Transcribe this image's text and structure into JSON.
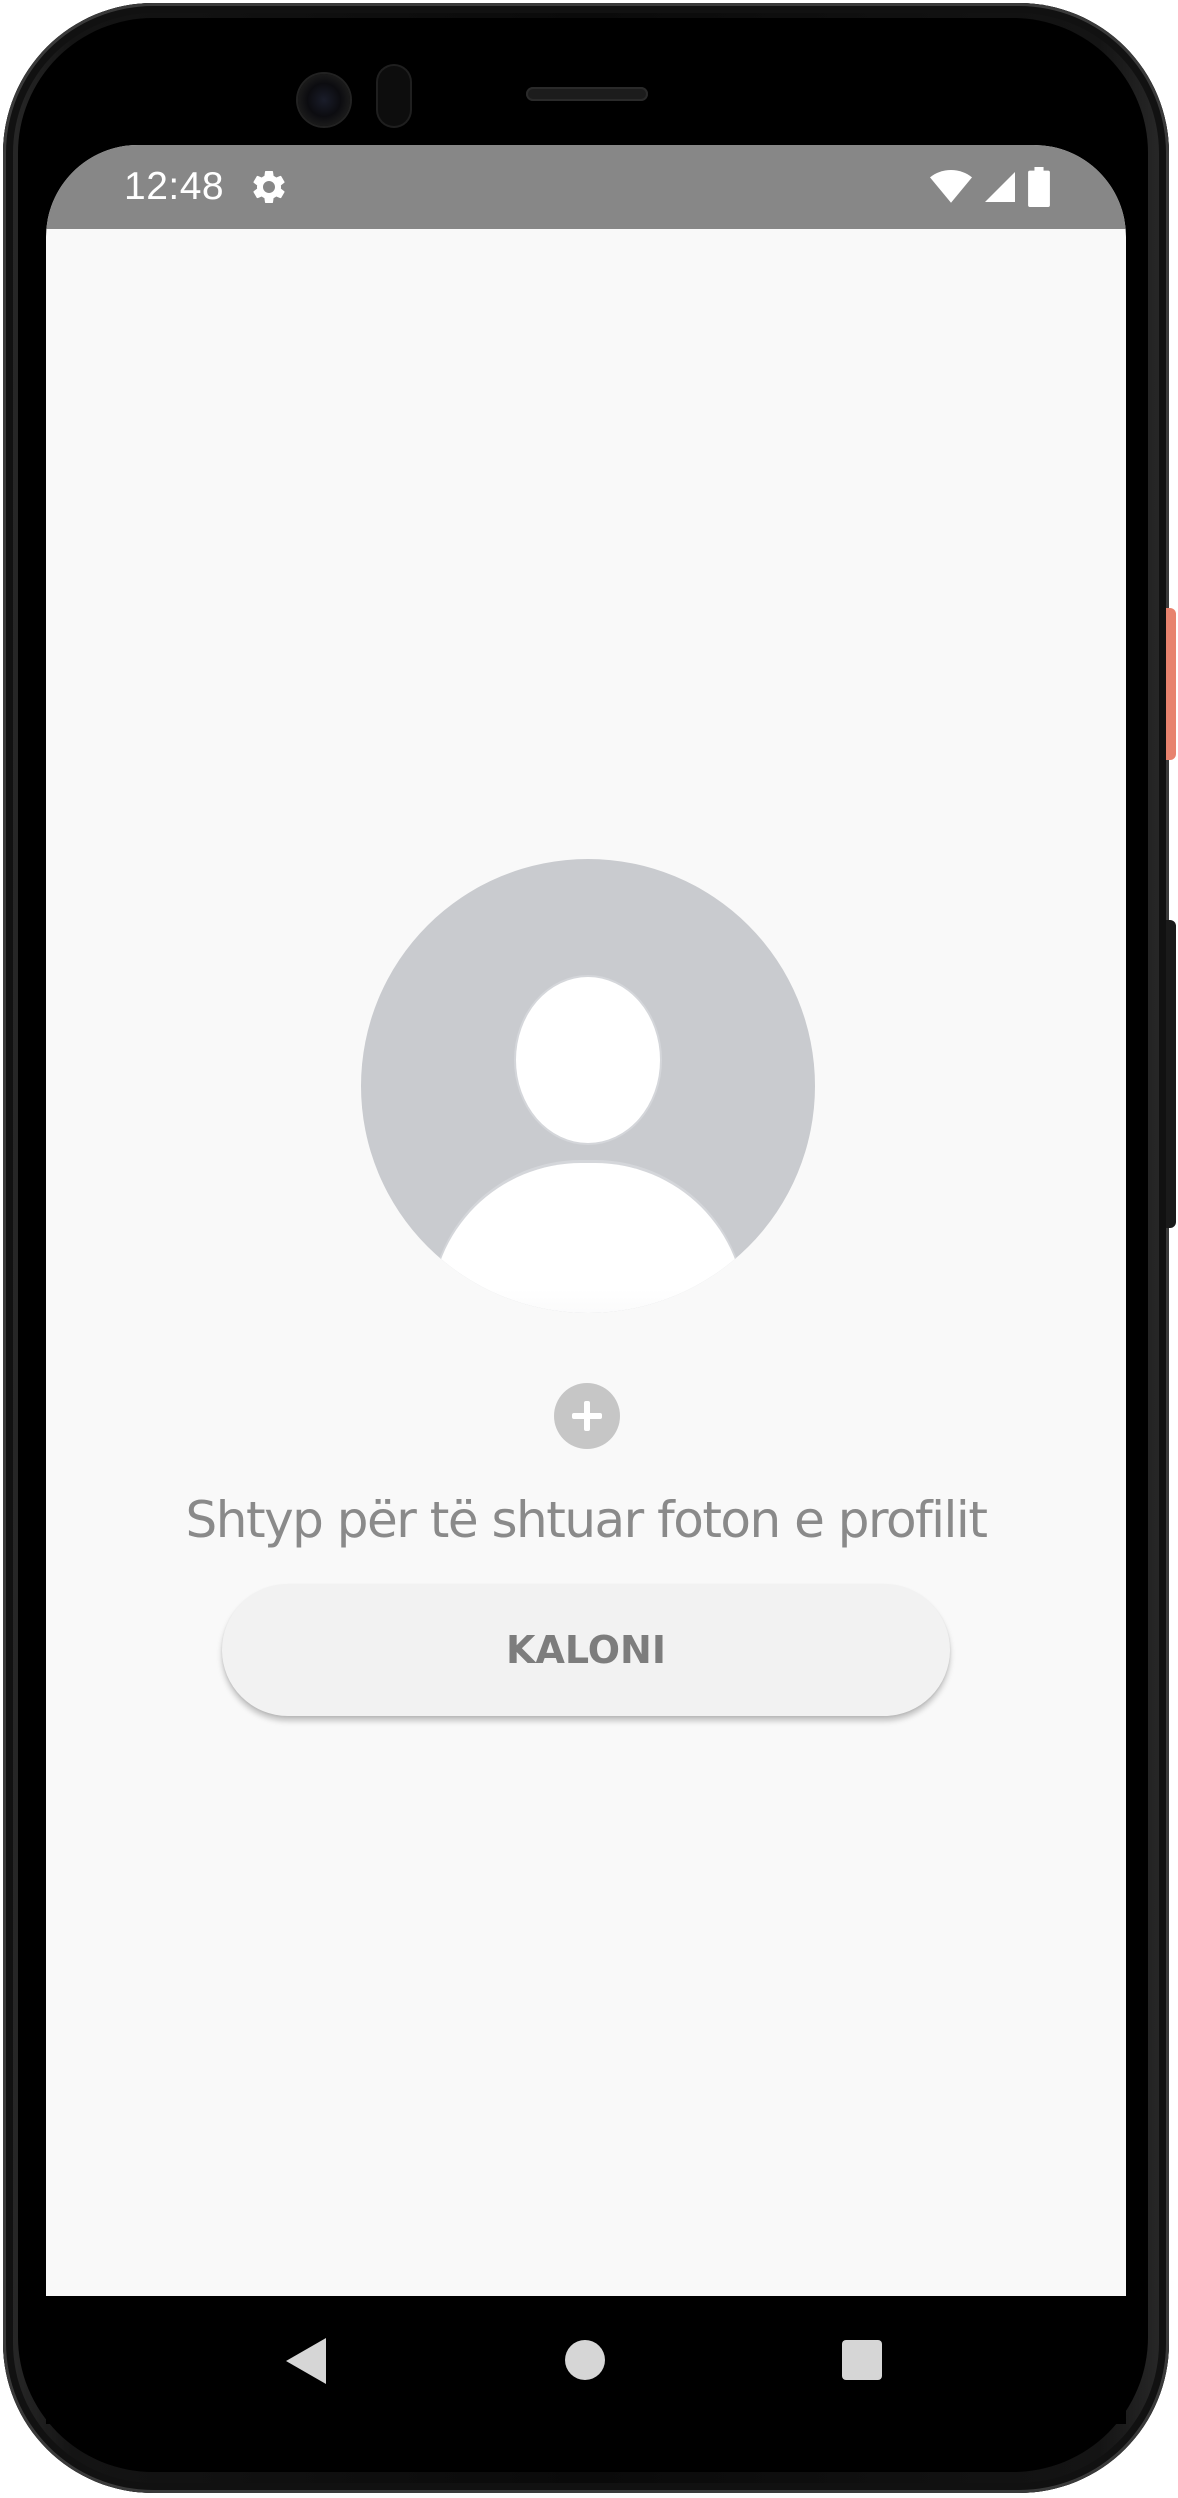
{
  "status_bar": {
    "time": "12:48",
    "icons": [
      "settings-icon",
      "wifi-icon",
      "cellular-signal-icon",
      "battery-icon"
    ],
    "background_color": "#878787"
  },
  "profile_setup": {
    "avatar_icon": "default-profile-avatar",
    "add_icon": "plus-icon",
    "prompt": "Shtyp për të shtuar foton e profilit",
    "skip_button_label": "KALONI"
  },
  "navigation_bar": {
    "buttons": [
      "back-icon",
      "home-icon",
      "recents-icon"
    ]
  },
  "colors": {
    "screen_background": "#f9f9f9",
    "avatar_background": "#c9cbcf",
    "text_secondary": "#8a8a8a",
    "button_background": "#f2f2f2",
    "add_button_background": "#c6c6c6"
  }
}
